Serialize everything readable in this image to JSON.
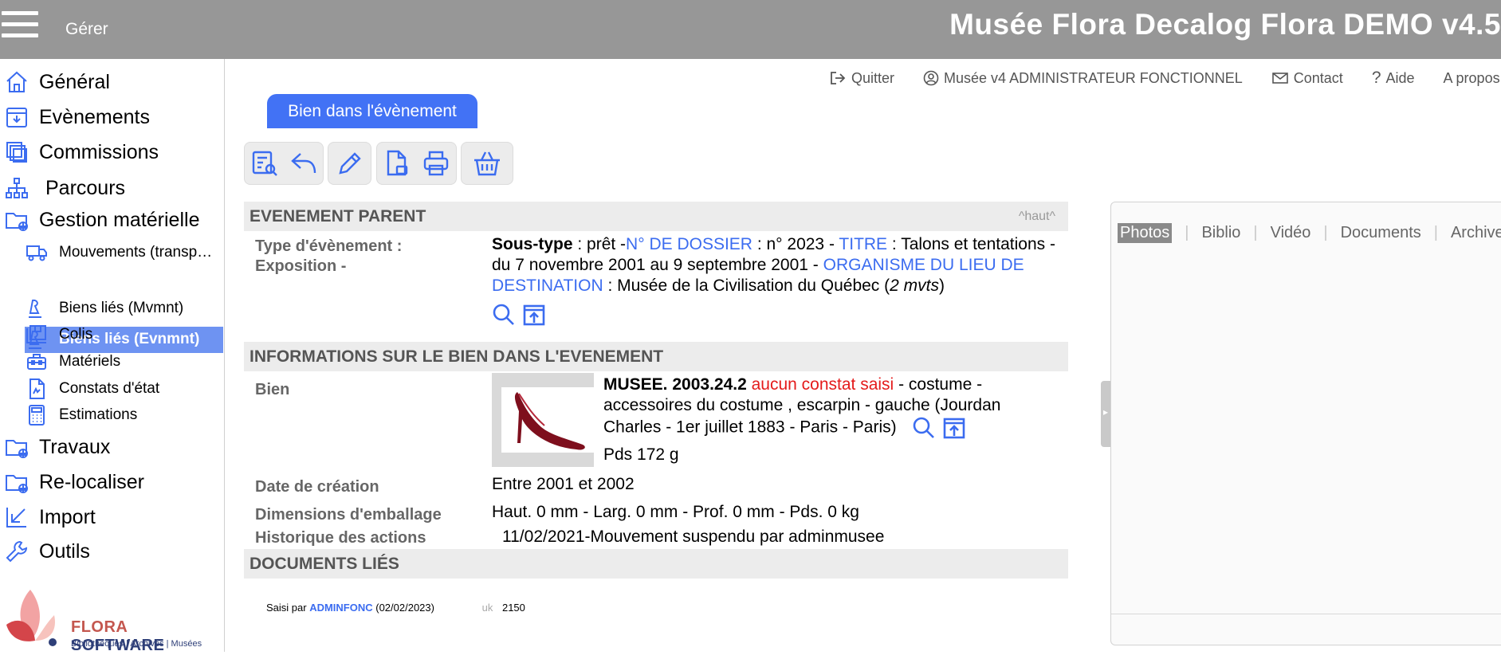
{
  "header": {
    "menu_label": "Gérer",
    "app_title": "Musée Flora Decalog Flora DEMO v4.5"
  },
  "sidebar": {
    "items": [
      {
        "label": "Général",
        "icon": "home-icon"
      },
      {
        "label": "Evènements",
        "icon": "inbox-icon"
      },
      {
        "label": "Commissions",
        "icon": "stack-icon"
      },
      {
        "label": "Parcours",
        "icon": "sitemap-icon"
      },
      {
        "label": "Gestion matérielle",
        "icon": "folder-globe-icon"
      },
      {
        "label": "Travaux",
        "icon": "folder-globe-icon"
      },
      {
        "label": "Re-localiser",
        "icon": "folder-globe-icon"
      },
      {
        "label": "Import",
        "icon": "import-arrow-icon"
      },
      {
        "label": "Outils",
        "icon": "wrench-icon"
      }
    ],
    "subitems": [
      {
        "label": "Mouvements (transp…",
        "icon": "truck-icon"
      },
      {
        "label": "Biens liés (Evnmnt)",
        "icon": "object-icon"
      },
      {
        "label": "Biens liés (Mvmnt)",
        "icon": "object-icon"
      },
      {
        "label": "Colis",
        "icon": "package-icon"
      },
      {
        "label": "Matériels",
        "icon": "toolbox-icon"
      },
      {
        "label": "Constats d'état",
        "icon": "document-icon"
      },
      {
        "label": "Estimations",
        "icon": "calculator-icon"
      }
    ],
    "logo": {
      "brand_a": "FLORA",
      "brand_b": "SOFTWARE",
      "tagline": "Bibliothèques | Archives | Musées"
    }
  },
  "top_links": {
    "quit": "Quitter",
    "user": "Musée v4 ADMINISTRATEUR FONCTIONNEL",
    "contact": "Contact",
    "help": "Aide",
    "about": "A propos"
  },
  "tab_label": "Bien dans l'évènement",
  "sections": {
    "parent": "EVENEMENT PARENT",
    "haut": "^haut^",
    "info": "INFORMATIONS SUR LE BIEN DANS L'EVENEMENT",
    "docs": "DOCUMENTS LIÉS"
  },
  "event": {
    "type_label": "Type d'évènement :",
    "type_value": "Exposition -",
    "subtype_label": "Sous-type",
    "subtype_value": " : prêt -",
    "dossier_label": "N° DE DOSSIER",
    "dossier_value": " : n° 2023 - ",
    "title_label": "TITRE",
    "title_value": " : Talons et tentations - du 7 novembre 2001 au 9 septembre 2001 - ",
    "org_label": "ORGANISME DU LIEU DE DESTINATION",
    "org_value": " : Musée de la Civilisation du Québec (",
    "mvts": "2 mvts",
    "close": ")"
  },
  "item": {
    "label": "Bien",
    "inventory": "MUSEE. 2003.24.2",
    "no_report": "aucun constat saisi",
    "description": " - costume - accessoires du costume , escarpin - gauche (Jourdan Charles - 1er juillet 1883 - Paris - Paris)",
    "weight": "Pds 172  g",
    "creation_label": "Date de création",
    "creation_value": "Entre 2001 et 2002",
    "pack_label": "Dimensions d'emballage",
    "pack_value": "Haut. 0 mm  - Larg. 0 mm  - Prof. 0 mm  - Pds. 0 kg",
    "history_label": "Historique des actions",
    "history_value": "11/02/2021-Mouvement suspendu par adminmusee"
  },
  "footer": {
    "entered_by": "Saisi par ",
    "user": "ADMINFONC",
    "date": " (02/02/2023)",
    "uk_label": "uk",
    "uk_value": "2150"
  },
  "media_tabs": [
    "Photos",
    "Biblio",
    "Vidéo",
    "Documents",
    "Archives"
  ],
  "colors": {
    "accent": "#3b6cf0",
    "header": "#979797",
    "tab": "#4272f5",
    "active_nav": "#6e93f2",
    "warning": "#e41b1b"
  }
}
